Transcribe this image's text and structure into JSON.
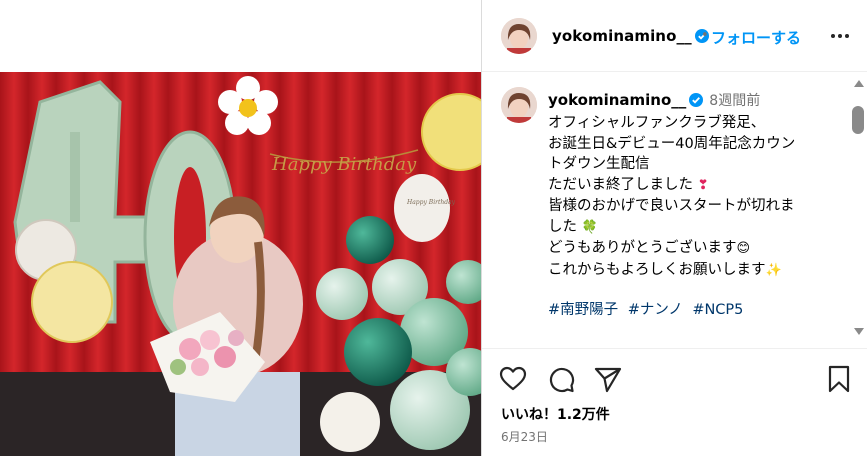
{
  "post": {
    "username": "yokominamino__",
    "follow_label": "フォローする",
    "separator": "•",
    "time_ago": "8週間前",
    "caption_lines": [
      "オフィシャルファンクラブ発足、",
      "お誕生日&デビュー40周年記念カウン",
      "トダウン生配信",
      "ただいま終了しました",
      "皆様のおかげで良いスタートが切れま",
      "した",
      "どうもありがとうございます",
      "これからもよろしくお願いします"
    ],
    "caption_emojis": {
      "line4": "❣",
      "line6": "🍀",
      "line7": "😊",
      "line8": "✨"
    },
    "hashtags": [
      "#南野陽子",
      "#ナンノ",
      "#NCP5"
    ],
    "likes_label": "いいね！1.2万件",
    "date": "6月23日"
  },
  "photo": {
    "balloon_number": "40",
    "banner_text": "Happy Birthday",
    "balloon_text": "Happy Birthday"
  },
  "icons": {
    "more": "more-horizontal-icon",
    "like": "heart-outline-icon",
    "comment": "comment-bubble-icon",
    "share": "paper-plane-icon",
    "save": "bookmark-outline-icon"
  },
  "colors": {
    "follow": "#0095f6",
    "hashtag": "#00376b",
    "muted": "#737373",
    "verified": "#0095f6",
    "curtain": "#c81f24"
  }
}
